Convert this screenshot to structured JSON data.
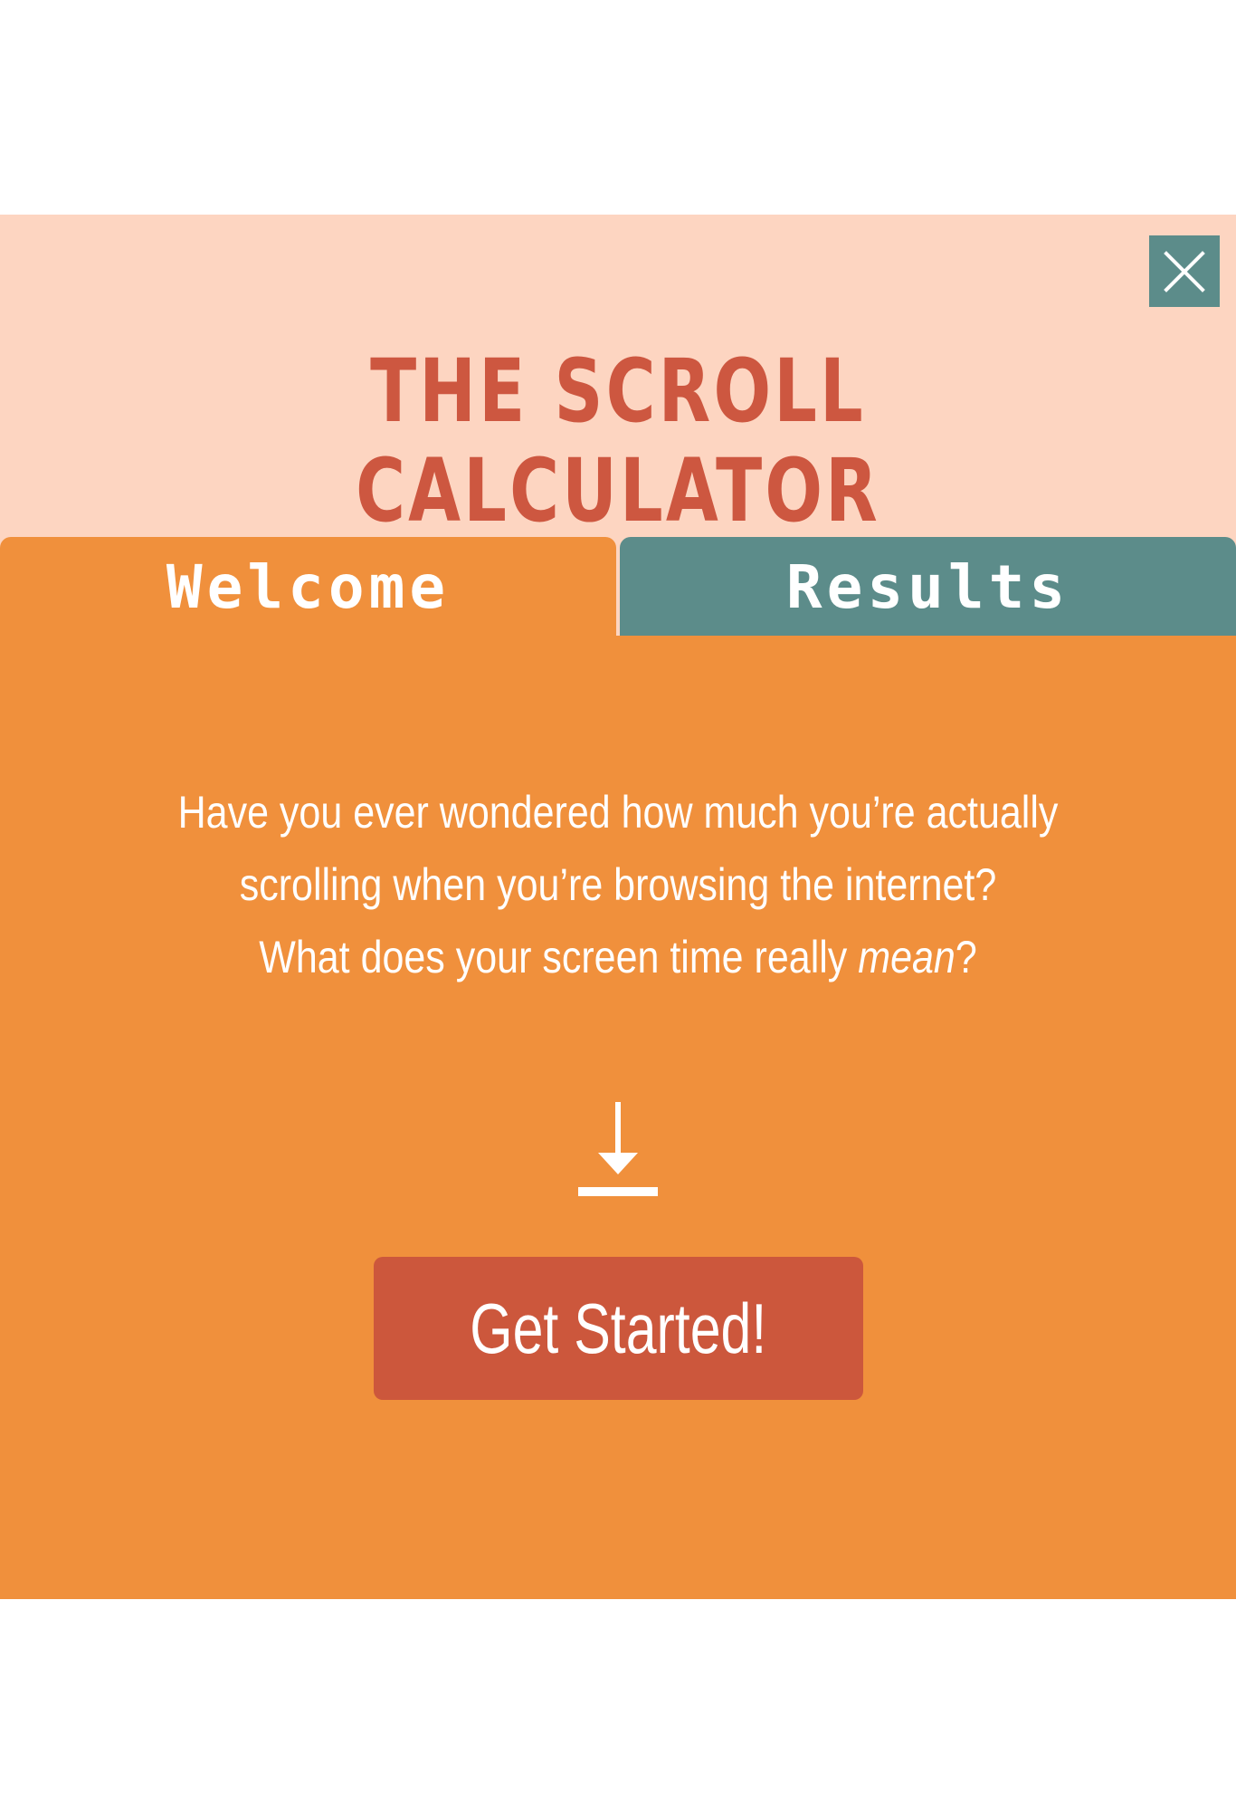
{
  "app": {
    "title": "THE SCROLL CALCULATOR"
  },
  "tabs": [
    {
      "label": "Welcome",
      "active": true
    },
    {
      "label": "Results",
      "active": false
    }
  ],
  "welcome": {
    "line1": "Have you ever wondered how much you’re actually",
    "line2": "scrolling when you’re browsing the internet?",
    "line3_prefix": "What does your screen time really ",
    "line3_emphasis": "mean",
    "line3_suffix": "?",
    "start_label": "Get Started!"
  },
  "icons": {
    "close": "close-icon",
    "down": "download-arrow-icon"
  },
  "colors": {
    "header_bg": "#fdd5c1",
    "accent_orange": "#f0903c",
    "accent_teal": "#5c8c8a",
    "accent_red": "#cd5740"
  }
}
